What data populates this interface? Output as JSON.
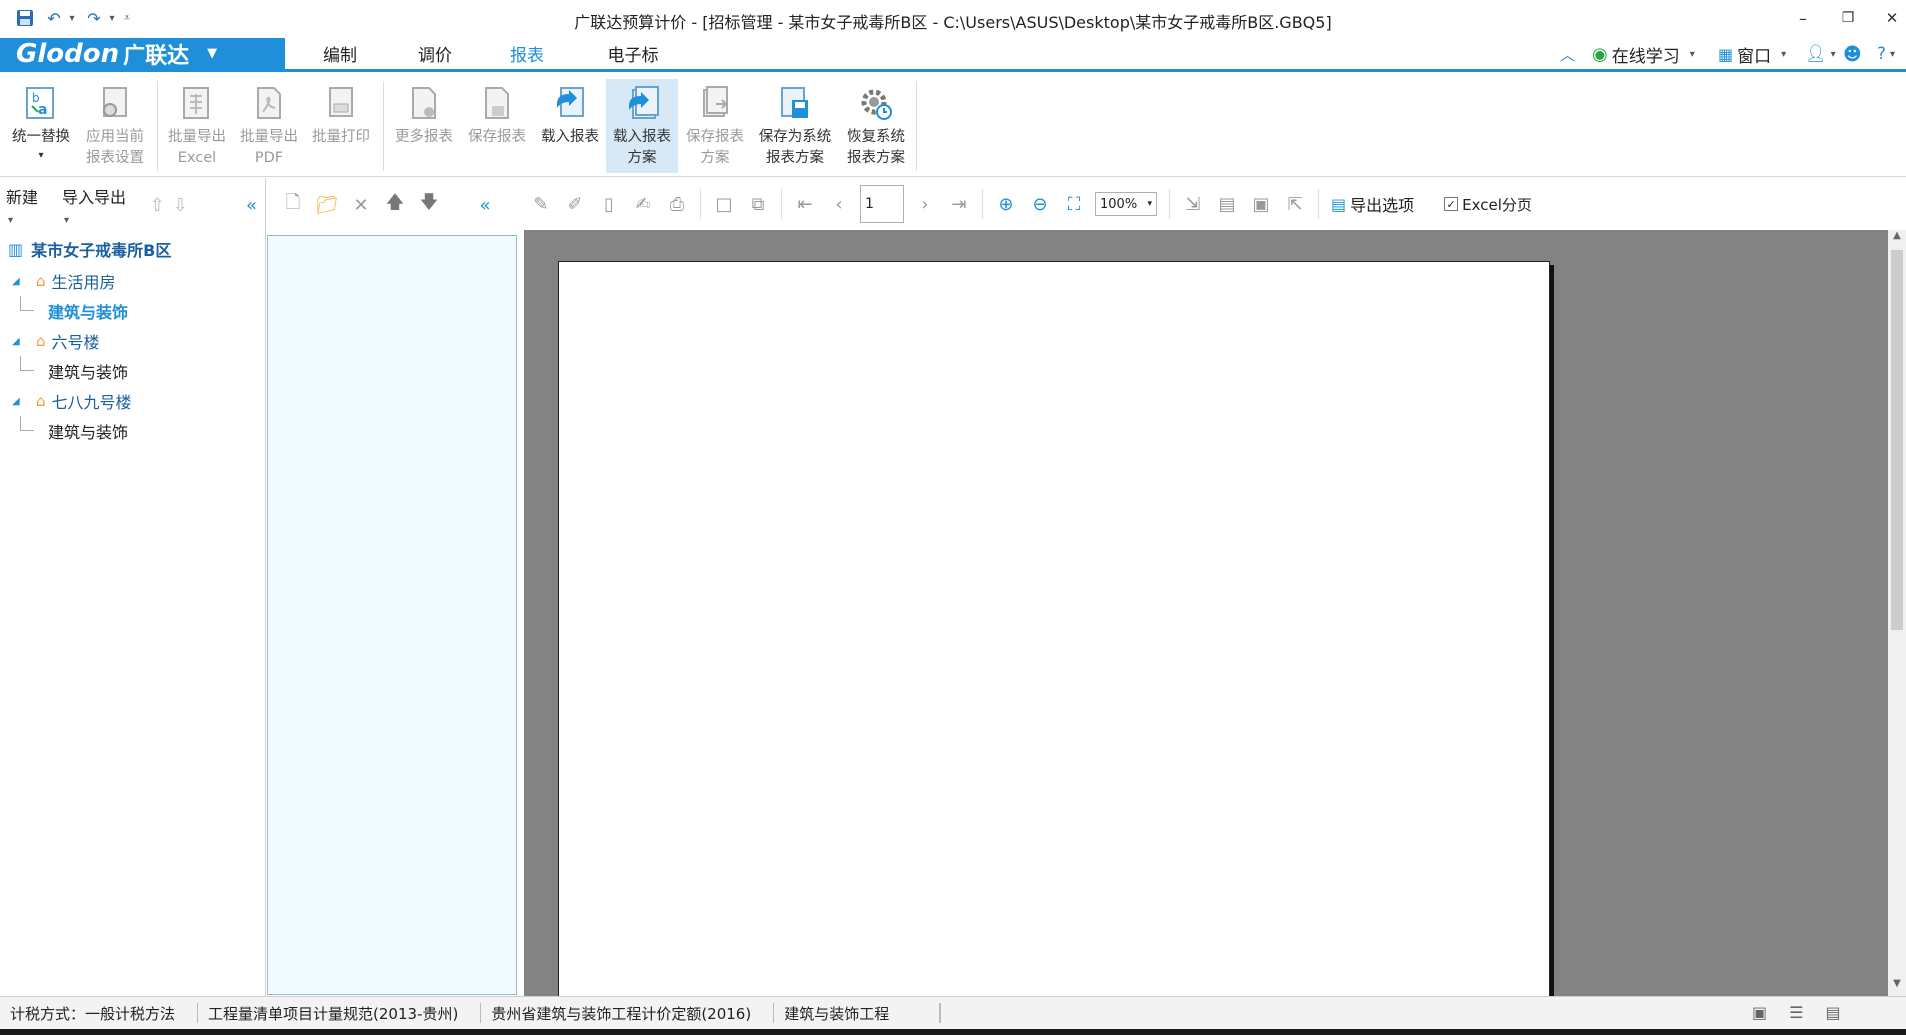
{
  "window": {
    "title": "广联达预算计价 - [招标管理 - 某市女子戒毒所B区 - C:\\Users\\ASUS\\Desktop\\某市女子戒毒所B区.GBQ5]"
  },
  "brand": {
    "logo": "Glodon",
    "cn": "广联达"
  },
  "menu": {
    "tabs": [
      {
        "label": "编制"
      },
      {
        "label": "调价"
      },
      {
        "label": "报表"
      },
      {
        "label": "电子标"
      }
    ],
    "online_learning": "在线学习",
    "window_label": "窗口",
    "help": "?"
  },
  "ribbon": {
    "buttons": [
      {
        "label1": "统一替换",
        "label2": ""
      },
      {
        "label1": "应用当前",
        "label2": "报表设置"
      },
      {
        "label1": "批量导出",
        "label2": "Excel"
      },
      {
        "label1": "批量导出",
        "label2": "PDF"
      },
      {
        "label1": "批量打印",
        "label2": ""
      },
      {
        "label1": "更多报表",
        "label2": ""
      },
      {
        "label1": "保存报表",
        "label2": ""
      },
      {
        "label1": "载入报表",
        "label2": ""
      },
      {
        "label1": "载入报表",
        "label2": "方案"
      },
      {
        "label1": "保存报表",
        "label2": "方案"
      },
      {
        "label1": "保存为系统",
        "label2": "报表方案"
      },
      {
        "label1": "恢复系统",
        "label2": "报表方案"
      }
    ]
  },
  "left_panel": {
    "new_label": "新建",
    "import_export_label": "导入导出",
    "project": "某市女子戒毒所B区",
    "tree": [
      {
        "label": "生活用房",
        "child": "建筑与装饰"
      },
      {
        "label": "六号楼",
        "child": "建筑与装饰"
      },
      {
        "label": "七八九号楼",
        "child": "建筑与装饰"
      }
    ]
  },
  "viewer": {
    "page_number": "1",
    "zoom": "100%",
    "export_options": "导出选项",
    "excel_paging": "Excel分页"
  },
  "status": {
    "tax": "计税方式：一般计税方法",
    "spec": "工程量清单项目计量规范(2013-贵州)",
    "quota": "贵州省建筑与装饰工程计价定额(2016)",
    "type": "建筑与装饰工程"
  }
}
